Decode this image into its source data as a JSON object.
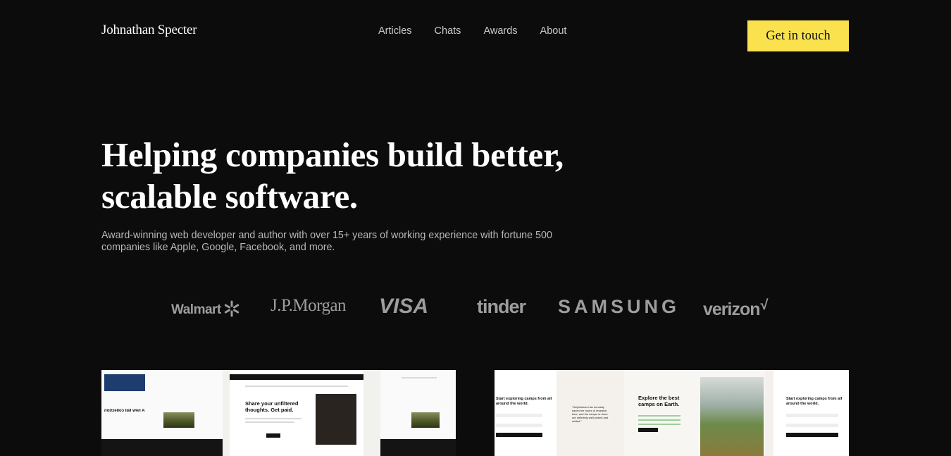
{
  "header": {
    "brand": "Johnathan Specter",
    "nav": [
      {
        "label": "Articles"
      },
      {
        "label": "Chats"
      },
      {
        "label": "Awards"
      },
      {
        "label": "About"
      }
    ],
    "cta_label": "Get in touch",
    "cta_color": "#f9e24e"
  },
  "hero": {
    "title_line1": "Helping companies build better,",
    "title_line2": "scalable software.",
    "subtitle_line1": "Award-winning web developer and author with over 15+ years of working experience with fortune 500",
    "subtitle_line2": "companies like Apple, Google, Facebook, and more."
  },
  "logos": {
    "walmart": "Walmart",
    "jpmorgan": "J.P.Morgan",
    "visa": "VISA",
    "tinder": "tinder",
    "samsung": "SAMSUNG",
    "verizon": "verizon",
    "verizon_mark": "√"
  },
  "showcase": {
    "shot_a": {
      "headline": "Share your unfiltered thoughts. Get paid.",
      "mirrored_text": "A new fall collection"
    },
    "shot_b": {
      "left_heading": "Start exploring camps from all around the world.",
      "quote": "“Helpfulness has honestly saved me hours of research time, and the camps on here are definitely well picked and added.”",
      "center_heading": "Explore the best camps on Earth.",
      "right_heading": "Start exploring camps from all around the world."
    }
  },
  "colors": {
    "background": "#0d0c0c",
    "accent": "#f9e24e",
    "logo_gray": "#9d9d9d"
  }
}
